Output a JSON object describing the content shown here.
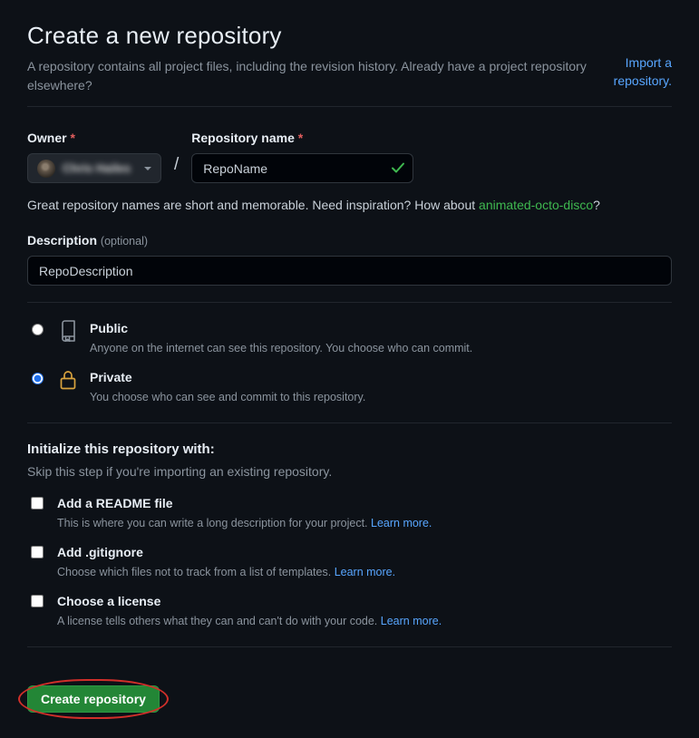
{
  "header": {
    "title": "Create a new repository",
    "subtitle": "A repository contains all project files, including the revision history. Already have a project repository elsewhere?",
    "import_line1": "Import a",
    "import_line2": "repository."
  },
  "form": {
    "owner_label": "Owner",
    "owner_value": "Chris Hailes",
    "reponame_label": "Repository name",
    "reponame_value": "RepoName",
    "hint_prefix": "Great repository names are short and memorable. Need inspiration? How about ",
    "hint_suggestion": "animated-octo-disco",
    "hint_suffix": "?",
    "description_label": "Description",
    "description_optional": "(optional)",
    "description_value": "RepoDescription"
  },
  "visibility": {
    "public": {
      "title": "Public",
      "sub": "Anyone on the internet can see this repository. You choose who can commit."
    },
    "private": {
      "title": "Private",
      "sub": "You choose who can see and commit to this repository."
    },
    "selected": "private"
  },
  "initialize": {
    "heading": "Initialize this repository with:",
    "sub": "Skip this step if you're importing an existing repository.",
    "readme": {
      "title": "Add a README file",
      "sub": "This is where you can write a long description for your project. ",
      "learn": "Learn more."
    },
    "gitignore": {
      "title": "Add .gitignore",
      "sub": "Choose which files not to track from a list of templates. ",
      "learn": "Learn more."
    },
    "license": {
      "title": "Choose a license",
      "sub": "A license tells others what they can and can't do with your code. ",
      "learn": "Learn more."
    }
  },
  "actions": {
    "create": "Create repository"
  }
}
